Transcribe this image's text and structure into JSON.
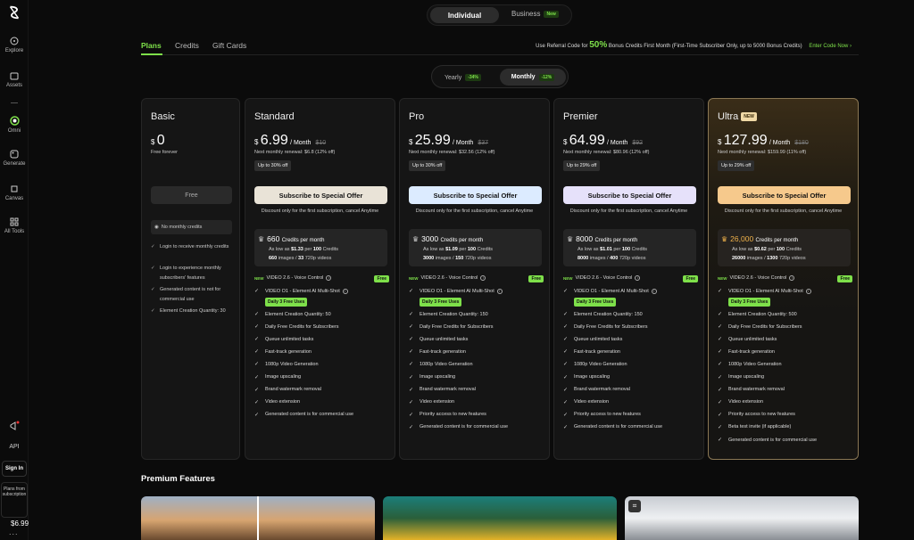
{
  "sidebar": {
    "items": [
      {
        "label": "Explore",
        "icon": "compass-icon"
      },
      {
        "label": "Assets",
        "icon": "folder-icon"
      },
      {
        "label": "Omni",
        "icon": "omni-icon"
      },
      {
        "label": "Generate",
        "icon": "generate-icon"
      },
      {
        "label": "Canvas",
        "icon": "canvas-icon"
      },
      {
        "label": "All Tools",
        "icon": "grid-icon"
      }
    ],
    "api_label": "API",
    "signin_label": "Sign In",
    "plan_line1": "Plans from",
    "plan_price": "$6.99",
    "plan_line2": "subscription",
    "more": "..."
  },
  "top_segment": {
    "active": "Individual",
    "other": "Business",
    "new_badge": "New"
  },
  "tabs": [
    "Plans",
    "Credits",
    "Gift Cards"
  ],
  "referral": {
    "prefix": "Use Referral Code for",
    "big": "50%",
    "suffix": "Bonus Credits First Month (First-Time Subscriber Only, up to 5000 Bonus Credits)",
    "link": "Enter Code Now ›"
  },
  "billing": {
    "yearly": "Yearly",
    "yearly_pct": "-34%",
    "monthly": "Monthly",
    "monthly_pct": "-12%"
  },
  "basic": {
    "name": "Basic",
    "currency": "$",
    "price": "0",
    "sub": "Free forever",
    "button": "Free",
    "no_credits": "No monthly credits",
    "features": [
      "Login to receive monthly credits",
      "Login to experience monthly subscribers' features",
      "Generated content is not for commercial use",
      "Element Creation Quantity: 30"
    ]
  },
  "common": {
    "subscribe": "Subscribe to Special Offer",
    "discount": "Discount only for the first subscription, cancel Anytime",
    "per_month": "/ Month",
    "credits_per_month": "Credits per month",
    "new_tag": "NEW",
    "video26": "VIDEO 2.6 - Voice Control",
    "free": "Free",
    "video_o1": "VIDEO O1 - Element AI Multi-Shot",
    "daily_free": "Daily 3 Free Uses",
    "as_low": "As low as",
    "per": "per",
    "credits": "Credits",
    "images": "images /",
    "videos": "720p videos"
  },
  "plans": [
    {
      "name": "Standard",
      "currency": "$",
      "price": "6.99",
      "old": "$10",
      "renew": "Next monthly renewal: $6.8 (12% off)",
      "off": "Up to 30% off",
      "credits": "660",
      "low": "$1.33",
      "per_n": "100",
      "imgs": "660",
      "vids": "33",
      "btn_color": "#e9e3d7",
      "features": [
        "Element Creation Quantity: 50",
        "Daily Free Credits for Subscribers",
        "Queue unlimited tasks",
        "Fast-track generation",
        "1080p Video Generation",
        "Image upscaling",
        "Brand watermark removal",
        "Video extension",
        "Generated content is for commercial use"
      ]
    },
    {
      "name": "Pro",
      "currency": "$",
      "price": "25.99",
      "old": "$37",
      "renew": "Next monthly renewal: $32.56 (12% off)",
      "off": "Up to 30% off",
      "credits": "3000",
      "low": "$1.09",
      "per_n": "100",
      "imgs": "3000",
      "vids": "150",
      "btn_color": "#dcebff",
      "features": [
        "Element Creation Quantity: 150",
        "Daily Free Credits for Subscribers",
        "Queue unlimited tasks",
        "Fast-track generation",
        "1080p Video Generation",
        "Image upscaling",
        "Brand watermark removal",
        "Video extension",
        "Priority access to new features",
        "Generated content is for commercial use"
      ]
    },
    {
      "name": "Premier",
      "currency": "$",
      "price": "64.99",
      "old": "$92",
      "renew": "Next monthly renewal: $80.96 (12% off)",
      "off": "Up to 29% off",
      "credits": "8000",
      "low": "$1.01",
      "per_n": "100",
      "imgs": "8000",
      "vids": "400",
      "btn_color": "#e6e1fa",
      "features": [
        "Element Creation Quantity: 150",
        "Daily Free Credits for Subscribers",
        "Queue unlimited tasks",
        "Fast-track generation",
        "1080p Video Generation",
        "Image upscaling",
        "Brand watermark removal",
        "Video extension",
        "Priority access to new features",
        "Generated content is for commercial use"
      ]
    },
    {
      "name": "Ultra",
      "new_badge": "NEW",
      "currency": "$",
      "price": "127.99",
      "old": "$180",
      "renew": "Next monthly renewal: $159.99 (11% off)",
      "off": "Up to 29% off",
      "credits": "26,000",
      "low": "$0.62",
      "per_n": "100",
      "imgs": "26000",
      "vids": "1300",
      "btn_color": "#f6c98c",
      "features": [
        "Element Creation Quantity: 500",
        "Daily Free Credits for Subscribers",
        "Queue unlimited tasks",
        "Fast-track generation",
        "1080p Video Generation",
        "Image upscaling",
        "Brand watermark removal",
        "Video extension",
        "Priority access to new features",
        "Beta test invite (if applicable)",
        "Generated content is for commercial use"
      ]
    }
  ],
  "premium_heading": "Premium Features"
}
